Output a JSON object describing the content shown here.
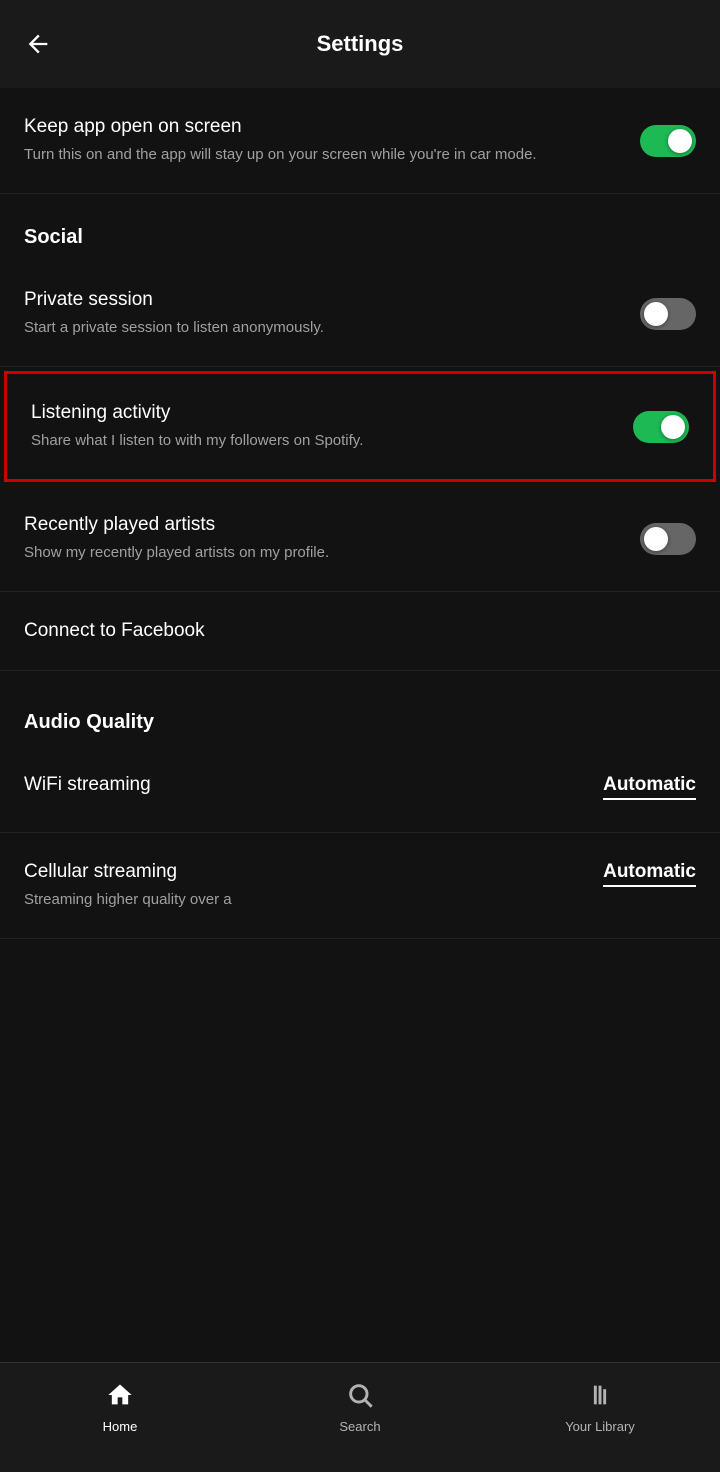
{
  "header": {
    "title": "Settings",
    "back_label": "←"
  },
  "settings": {
    "keep_app_open": {
      "title": "Keep app open on screen",
      "description": "Turn this on and the app will stay up on your screen while you're in car mode.",
      "toggle": "on"
    },
    "social_section": {
      "label": "Social"
    },
    "private_session": {
      "title": "Private session",
      "description": "Start a private session to listen anonymously.",
      "toggle": "off"
    },
    "listening_activity": {
      "title": "Listening activity",
      "description": "Share what I listen to with my followers on Spotify.",
      "toggle": "on"
    },
    "recently_played": {
      "title": "Recently played artists",
      "description": "Show my recently played artists on my profile.",
      "toggle": "off"
    },
    "connect_facebook": {
      "label": "Connect to Facebook"
    },
    "audio_quality_section": {
      "label": "Audio Quality"
    },
    "wifi_streaming": {
      "title": "WiFi streaming",
      "value": "Automatic"
    },
    "cellular_streaming": {
      "title": "Cellular streaming",
      "description": "Streaming higher quality over a",
      "value": "Automatic"
    }
  },
  "bottom_nav": {
    "home": {
      "label": "Home",
      "active": true
    },
    "search": {
      "label": "Search",
      "active": false
    },
    "library": {
      "label": "Your Library",
      "active": false
    }
  },
  "android_nav": {
    "square_label": "■",
    "circle_label": "○",
    "triangle_label": "◀"
  }
}
